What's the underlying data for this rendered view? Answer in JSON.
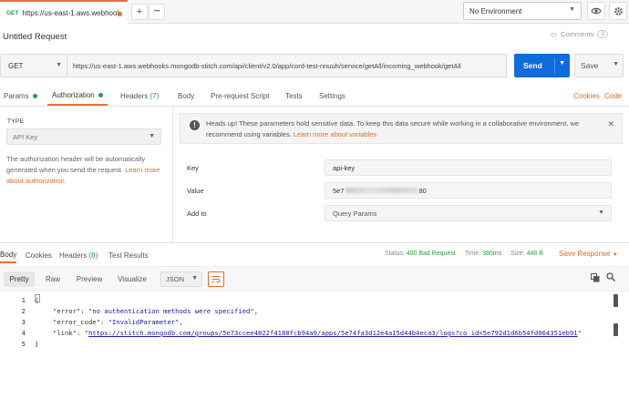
{
  "tabbar": {
    "tab_method": "GET",
    "tab_title": "https://us-east-1.aws.webhook",
    "add_label": "+",
    "more_label": "•••",
    "environment": "No Environment"
  },
  "request": {
    "title": "Untitled Request",
    "comments_label": "Comments",
    "comments_count": "0",
    "method": "GET",
    "url": "https://us-east-1.aws.webhooks.mongodb-stitch.com/api/client/v2.0/app/cord-test-nnuuh/service/getAll/incoming_webhook/getAll",
    "send_label": "Send",
    "save_label": "Save"
  },
  "req_tabs": {
    "params": "Params",
    "authorization": "Authorization",
    "headers": "Headers",
    "headers_count": "(7)",
    "body": "Body",
    "prerequest": "Pre-request Script",
    "tests": "Tests",
    "settings": "Settings",
    "cookies": "Cookies",
    "code": "Code"
  },
  "auth": {
    "type_label": "TYPE",
    "type_value": "API Key",
    "description": "The authorization header will be automatically generated when you send the request.",
    "learn_more": "Learn more about authorization",
    "notice_text": "Heads up! These parameters hold sensitive data. To keep this data secure while working in a collaborative environment, we recommend using variables.",
    "notice_link": "Learn more about variables",
    "key_label": "Key",
    "key_value": "api-key",
    "value_label": "Value",
    "value_prefix": "5e7",
    "value_suffix": "80",
    "addto_label": "Add to",
    "addto_value": "Query Params"
  },
  "response": {
    "tabs": {
      "body": "Body",
      "cookies": "Cookies",
      "headers": "Headers",
      "headers_count": "(8)",
      "test_results": "Test Results"
    },
    "status_label": "Status:",
    "status_value": "400 Bad Request",
    "time_label": "Time:",
    "time_value": "380ms",
    "size_label": "Size:",
    "size_value": "448 B",
    "save_response": "Save Response",
    "views": {
      "pretty": "Pretty",
      "raw": "Raw",
      "preview": "Preview",
      "visualize": "Visualize"
    },
    "format": "JSON",
    "code_lines": {
      "l1": "{",
      "l2_key": "\"error\"",
      "l2_val": "\"no authentication methods were specified\"",
      "l3_key": "\"error_code\"",
      "l3_val": "\"InvalidParameter\"",
      "l4_key": "\"link\"",
      "l4_val": "https://stitch.mongodb.com/groups/5e73ccee4822f4188fcb94a9/apps/5e74fa3d12e4a15d44b4eca3/logs?co_id=5e792d1d6b54fd064351eb91",
      "l5": "}"
    },
    "line_numbers": [
      "1",
      "2",
      "3",
      "4",
      "5"
    ]
  },
  "colors": {
    "accent": "#f26b3a",
    "send": "#0f6cdb",
    "success": "#2a9d3f"
  }
}
